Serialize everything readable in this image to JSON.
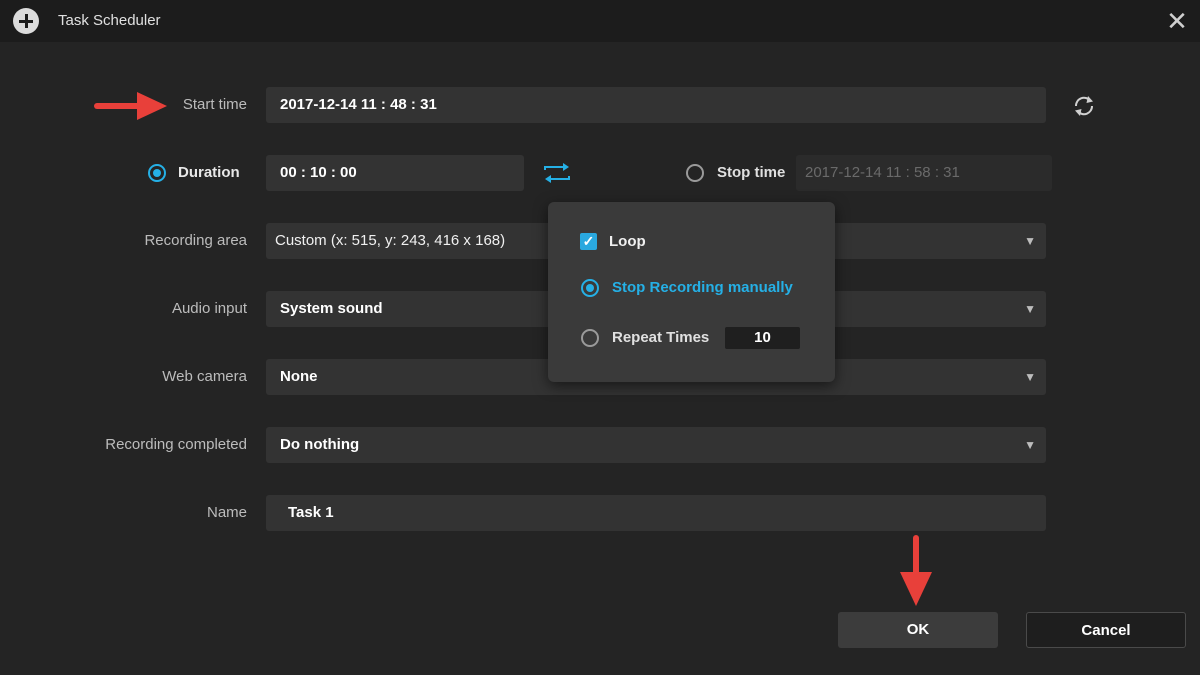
{
  "window": {
    "title": "Task Scheduler"
  },
  "start_time": {
    "label": "Start time",
    "value": "2017-12-14 11 : 48 : 31"
  },
  "duration": {
    "label": "Duration",
    "value": "00 : 10 : 00",
    "selected": true
  },
  "stop_time": {
    "label": "Stop time",
    "value": "2017-12-14 11 : 58 : 31",
    "selected": false
  },
  "recording_area": {
    "label": "Recording area",
    "value": "Custom (x: 515, y: 243, 416 x 168)"
  },
  "audio_input": {
    "label": "Audio input",
    "value": "System sound"
  },
  "web_camera": {
    "label": "Web camera",
    "value": "None"
  },
  "recording_completed": {
    "label": "Recording completed",
    "value": "Do nothing"
  },
  "name": {
    "label": "Name",
    "value": "Task 1"
  },
  "loop_popup": {
    "loop_label": "Loop",
    "loop_checked": true,
    "stop_manual_label": "Stop Recording manually",
    "stop_manual_selected": true,
    "repeat_label": "Repeat Times",
    "repeat_value": "10"
  },
  "buttons": {
    "ok": "OK",
    "cancel": "Cancel"
  },
  "colors": {
    "accent": "#25b0e6",
    "annotation_arrow": "#e8403a"
  },
  "icons": [
    "add-icon",
    "close-icon",
    "refresh-icon",
    "swap-icon",
    "chevron-down-icon",
    "check-icon"
  ]
}
